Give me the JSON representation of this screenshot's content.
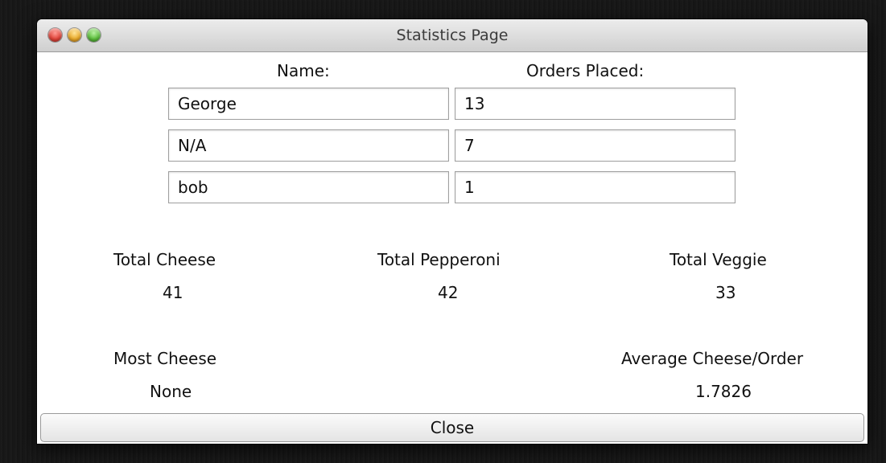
{
  "window": {
    "title": "Statistics Page"
  },
  "table": {
    "headers": {
      "name": "Name:",
      "orders": "Orders Placed:"
    },
    "rows": [
      {
        "name": "George",
        "orders": "13"
      },
      {
        "name": "N/A",
        "orders": "7"
      },
      {
        "name": "bob",
        "orders": "1"
      }
    ]
  },
  "totals": {
    "cheese_label": "Total Cheese",
    "cheese_value": "41",
    "pepperoni_label": "Total Pepperoni",
    "pepperoni_value": "42",
    "veggie_label": "Total Veggie",
    "veggie_value": "33"
  },
  "stats": {
    "most_cheese_label": "Most Cheese",
    "most_cheese_value": "None",
    "avg_label": "Average Cheese/Order",
    "avg_value": "1.7826"
  },
  "buttons": {
    "close": "Close"
  },
  "icons": {
    "close_light": "close-window-icon",
    "minimize_light": "minimize-window-icon",
    "zoom_light": "zoom-window-icon"
  }
}
